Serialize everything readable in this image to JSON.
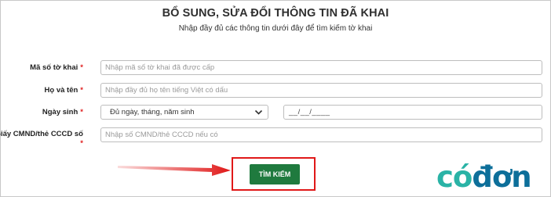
{
  "page": {
    "title": "BỔ SUNG, SỬA ĐỔI THÔNG TIN ĐÃ KHAI",
    "subtitle": "Nhập đầy đủ các thông tin dưới đây để tìm kiếm tờ khai"
  },
  "form": {
    "required_mark": "*",
    "declaration_code": {
      "label": "Mã số tờ khai",
      "placeholder": "Nhập mã số tờ khai đã được cấp",
      "value": ""
    },
    "full_name": {
      "label": "Họ và tên",
      "placeholder": "Nhập đầy đủ họ tên tiếng Việt có dấu",
      "value": ""
    },
    "birth_date": {
      "label": "Ngày sinh",
      "format_selected": "Đủ ngày, tháng, năm sinh",
      "date_value": "__/__/____"
    },
    "id_number": {
      "label": "Giấy CMND/thẻ CCCD số",
      "placeholder": "Nhập số CMND/thẻ CCCD nếu có",
      "value": ""
    },
    "search_button": "TÌM KIẾM"
  },
  "annotation": {
    "highlight_color": "#e01818",
    "arrow_color": "#e01818"
  },
  "logo": {
    "part1": "có",
    "part2": "đơn"
  }
}
